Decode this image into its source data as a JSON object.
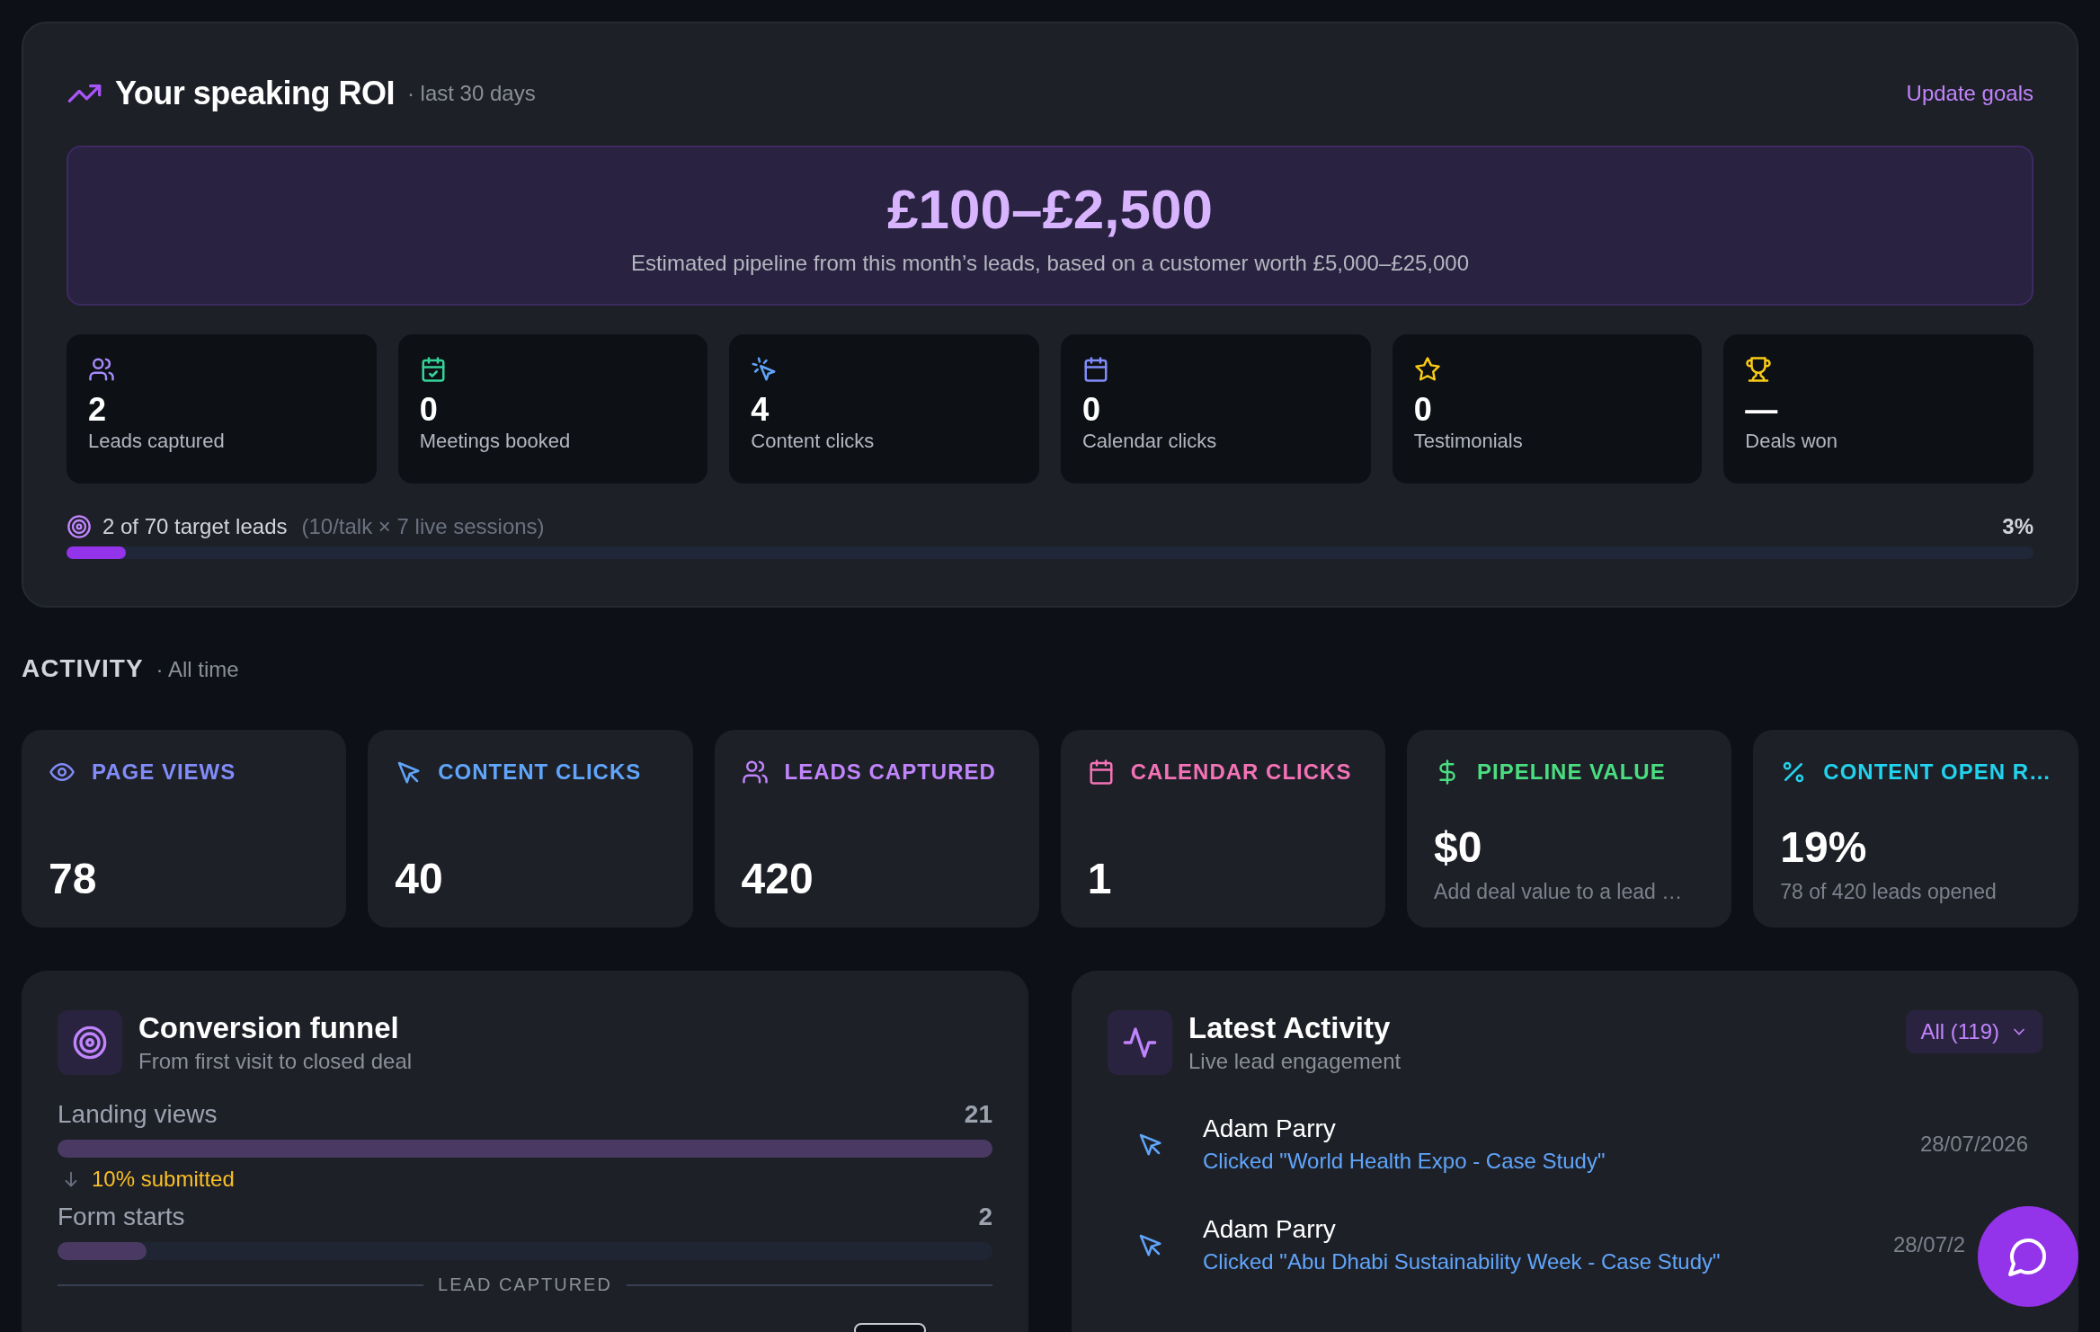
{
  "roi": {
    "title": "Your speaking ROI",
    "period": "· last 30 days",
    "update_link": "Update goals",
    "estimate": {
      "value": "£100–£2,500",
      "caption": "Estimated pipeline from this month’s leads, based on a customer worth £5,000–£25,000"
    },
    "stats": [
      {
        "value": "2",
        "label": "Leads captured",
        "color": "#a78bfa"
      },
      {
        "value": "0",
        "label": "Meetings booked",
        "color": "#34d399"
      },
      {
        "value": "4",
        "label": "Content clicks",
        "color": "#60a5fa"
      },
      {
        "value": "0",
        "label": "Calendar clicks",
        "color": "#818cf8"
      },
      {
        "value": "0",
        "label": "Testimonials",
        "color": "#facc15"
      },
      {
        "value": "—",
        "label": "Deals won",
        "color": "#facc15"
      }
    ],
    "target": {
      "label": "2 of 70 target leads",
      "detail": "(10/talk × 7 live sessions)",
      "percent": "3%",
      "level": 0.03
    }
  },
  "activity": {
    "title": "ACTIVITY",
    "period": "· All time",
    "cards": [
      {
        "label": "PAGE VIEWS",
        "value": "78",
        "color": "#818cf8"
      },
      {
        "label": "CONTENT CLICKS",
        "value": "40",
        "color": "#60a5fa"
      },
      {
        "label": "LEADS CAPTURED",
        "value": "420",
        "color": "#c084fc"
      },
      {
        "label": "CALENDAR CLICKS",
        "value": "1",
        "color": "#f472b6"
      },
      {
        "label": "PIPELINE VALUE",
        "value": "$0",
        "note": "Add deal value to a lead …",
        "color": "#4ade80"
      },
      {
        "label": "CONTENT OPEN R…",
        "value": "19%",
        "note": "78 of 420 leads opened",
        "color": "#22d3ee"
      }
    ]
  },
  "funnel": {
    "title": "Conversion funnel",
    "subtitle": "From first visit to closed deal",
    "steps": [
      {
        "kind": "stage",
        "label": "Landing views",
        "count": "21",
        "level": 1.0
      },
      {
        "kind": "conversion",
        "label": "10% submitted"
      },
      {
        "kind": "stage",
        "label": "Form starts",
        "count": "2",
        "level": 0.095
      },
      {
        "kind": "divider",
        "label": "LEAD CAPTURED"
      }
    ]
  },
  "latest": {
    "title": "Latest Activity",
    "subtitle": "Live lead engagement",
    "filter": "All (119)",
    "items": [
      {
        "name": "Adam Parry",
        "action": "Clicked \"World Health Expo - Case Study\"",
        "date": "28/07/2026"
      },
      {
        "name": "Adam Parry",
        "action": "Clicked \"Abu Dhabi Sustainability Week - Case Study\"",
        "date": "28/07/2"
      }
    ]
  }
}
